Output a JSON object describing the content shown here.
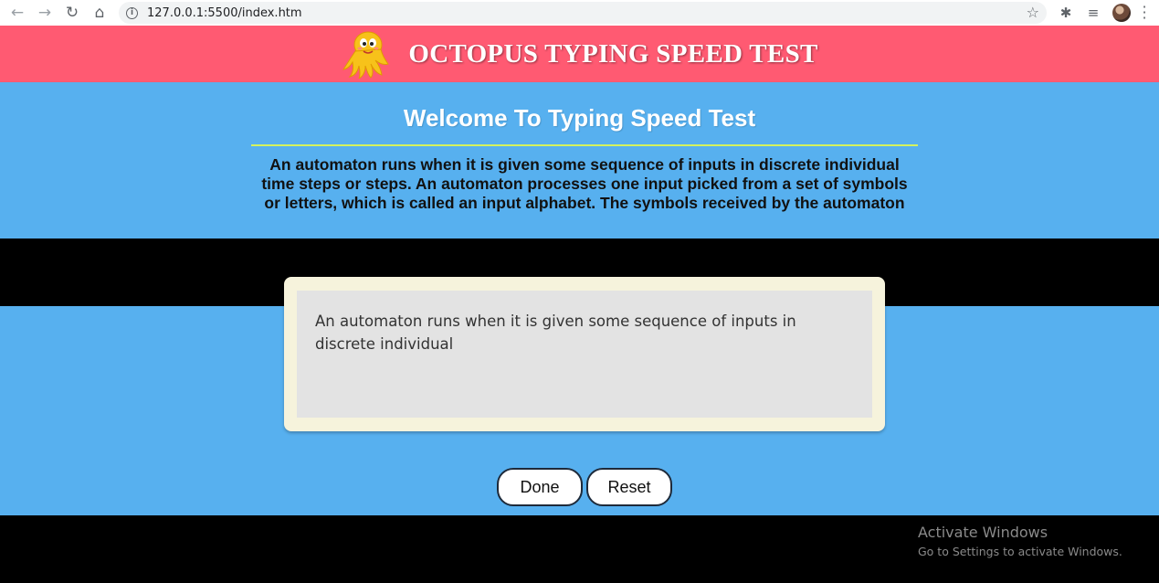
{
  "browser": {
    "url": "127.0.0.1:5500/index.htm",
    "icons": [
      "back-arrow-icon",
      "forward-arrow-icon",
      "reload-icon",
      "home-icon",
      "site-info-icon",
      "bookmark-star-icon",
      "extensions-icon",
      "reading-list-icon",
      "profile-avatar",
      "more-menu-icon"
    ]
  },
  "header": {
    "title": "OCTOPUS TYPING SPEED TEST",
    "logo_icon": "octopus-icon",
    "bg_color": "#ff5a72"
  },
  "main": {
    "bg_color": "#57b0ef",
    "welcome": "Welcome To Typing Speed Test",
    "prompt_text": "An automaton runs when it is given some sequence of inputs in discrete individual time steps or steps. An automaton processes one input picked from a set of symbols or letters, which is called an input alphabet. The symbols received by the automaton",
    "typing_value": "An automaton runs when it is given some sequence of inputs in discrete individual",
    "done_label": "Done",
    "reset_label": "Reset",
    "divider_color": "#d4f25e"
  },
  "os_watermark": {
    "title": "Activate Windows",
    "subtitle": "Go to Settings to activate Windows."
  }
}
